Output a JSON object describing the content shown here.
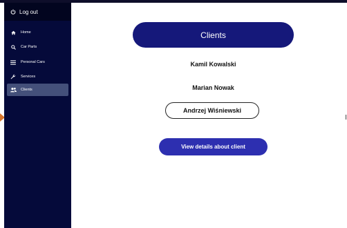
{
  "sidebar": {
    "logout_label": "Log out",
    "items": [
      {
        "label": "Home",
        "icon": "home-icon"
      },
      {
        "label": "Car Parts",
        "icon": "search-icon"
      },
      {
        "label": "Personal Cars",
        "icon": "menu-icon"
      },
      {
        "label": "Services",
        "icon": "wrench-icon"
      },
      {
        "label": "Clients",
        "icon": "users-icon",
        "active": true
      }
    ]
  },
  "main": {
    "title": "Clients",
    "clients": [
      "Kamil Kowalski",
      "Marian Nowak",
      "Andrzej Wiśniewski"
    ],
    "selected_client_index": 2,
    "details_button_label": "View details about client"
  },
  "colors": {
    "sidebar_bg": "#050a3a",
    "active_item_bg": "#44507a",
    "title_bg": "#15187a",
    "button_bg": "#2d2fb0"
  }
}
